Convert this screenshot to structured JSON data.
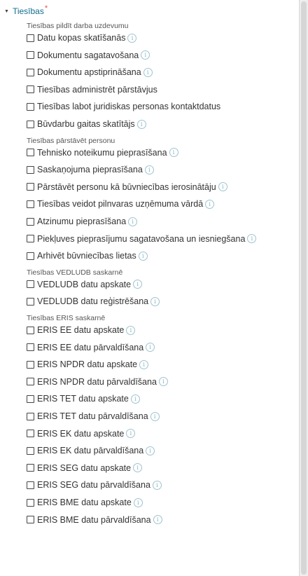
{
  "header": {
    "label": "Tiesības",
    "required_mark": "*"
  },
  "sections": [
    {
      "title": "Tiesības pildīt darba uzdevumu",
      "items": [
        {
          "label": "Datu kopas skatīšanās",
          "info": true
        },
        {
          "label": "Dokumentu sagatavošana",
          "info": true
        },
        {
          "label": "Dokumentu apstiprināšana",
          "info": true
        },
        {
          "label": "Tiesības administrēt pārstāvjus",
          "info": false
        },
        {
          "label": "Tiesības labot juridiskas personas kontaktdatus",
          "info": false
        },
        {
          "label": "Būvdarbu gaitas skatītājs",
          "info": true
        }
      ]
    },
    {
      "title": "Tiesības pārstāvēt personu",
      "items": [
        {
          "label": "Tehnisko noteikumu pieprasīšana",
          "info": true
        },
        {
          "label": "Saskaņojuma pieprasīšana",
          "info": true
        },
        {
          "label": "Pārstāvēt personu kā būvniecības ierosinātāju",
          "info": true
        },
        {
          "label": "Tiesības veidot pilnvaras uzņēmuma vārdā",
          "info": true
        },
        {
          "label": "Atzinumu pieprasīšana",
          "info": true
        },
        {
          "label": "Piekļuves pieprasījumu sagatavošana un iesniegšana",
          "info": true
        },
        {
          "label": "Arhivēt būvniecības lietas",
          "info": true
        }
      ]
    },
    {
      "title": "Tiesības VEDLUDB saskarnē",
      "items": [
        {
          "label": "VEDLUDB datu apskate",
          "info": true
        },
        {
          "label": "VEDLUDB datu reģistrēšana",
          "info": true
        }
      ]
    },
    {
      "title": "Tiesības ERIS saskarnē",
      "items": [
        {
          "label": "ERIS EE datu apskate",
          "info": true
        },
        {
          "label": "ERIS EE datu pārvaldīšana",
          "info": true
        },
        {
          "label": "ERIS NPDR datu apskate",
          "info": true
        },
        {
          "label": "ERIS NPDR datu pārvaldīšana",
          "info": true
        },
        {
          "label": "ERIS TET datu apskate",
          "info": true
        },
        {
          "label": "ERIS TET datu pārvaldīšana",
          "info": true
        },
        {
          "label": "ERIS EK datu apskate",
          "info": true
        },
        {
          "label": "ERIS EK datu pārvaldīšana",
          "info": true
        },
        {
          "label": "ERIS SEG datu apskate",
          "info": true
        },
        {
          "label": "ERIS SEG datu pārvaldīšana",
          "info": true
        },
        {
          "label": "ERIS BME datu apskate",
          "info": true
        },
        {
          "label": "ERIS BME datu pārvaldīšana",
          "info": true
        }
      ]
    }
  ]
}
